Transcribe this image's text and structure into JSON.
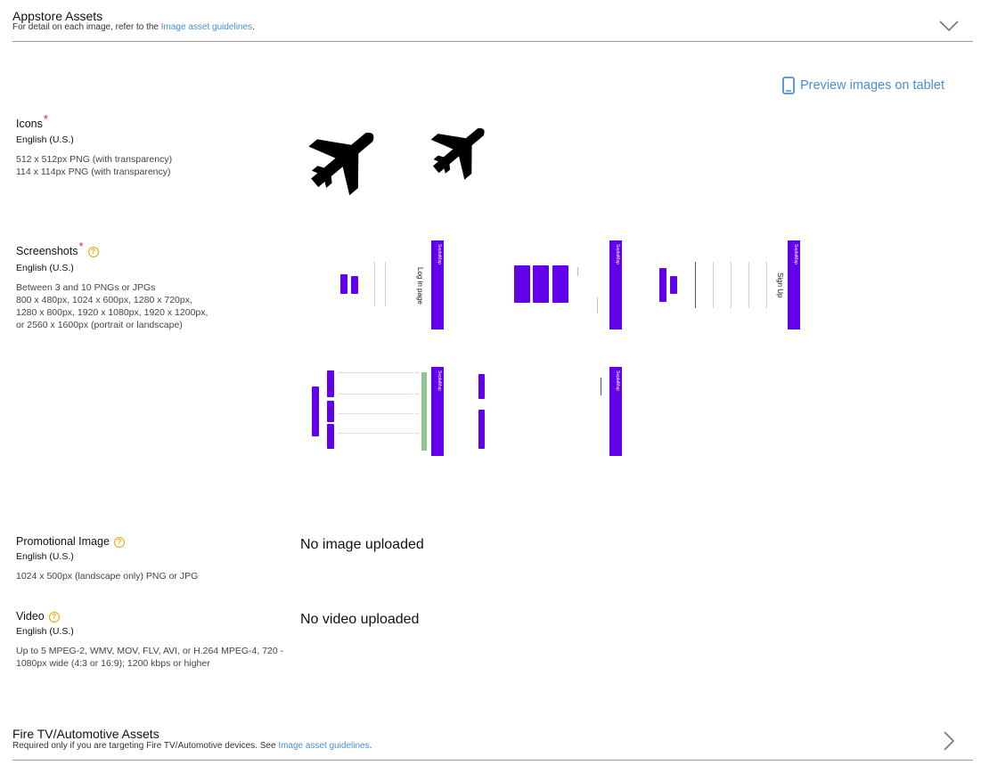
{
  "appstore": {
    "title": "Appstore Assets",
    "subtitle_prefix": "For detail on each image, refer to the ",
    "subtitle_link": "Image asset guidelines",
    "subtitle_suffix": "."
  },
  "preview_link": "Preview images on tablet",
  "icons": {
    "label": "Icons",
    "required_mark": "*",
    "locale": "English (U.S.)",
    "specs": [
      "512 x 512px PNG (with transparency)",
      "114 x 114px PNG (with transparency)"
    ]
  },
  "screenshots": {
    "label": "Screenshots",
    "required_mark": "*",
    "help": "?",
    "locale": "English (U.S.)",
    "specs": [
      "Between 3 and 10 PNGs or JPGs",
      "800 x 480px, 1024 x 600px, 1280 x 720px,",
      "1280 x 800px, 1920 x 1080px, 1920 x 1200px,",
      "or 2560 x 1600px (portrait or landscape)"
    ],
    "thumbs": {
      "app_name": "SeptaMap",
      "login_title": "Log in page",
      "signup_title": "Sign Up"
    }
  },
  "promo": {
    "label": "Promotional Image",
    "help": "?",
    "locale": "English (U.S.)",
    "spec": "1024 x 500px (landscape only) PNG or JPG",
    "status": "No image uploaded"
  },
  "video": {
    "label": "Video",
    "help": "?",
    "locale": "English (U.S.)",
    "specs": [
      "Up to 5 MPEG-2, WMV, MOV, FLV, AVI, or H.264 MPEG-4, 720 -",
      "1080px wide (4:3 or 16:9); 1200 kbps or higher"
    ],
    "status": "No video uploaded"
  },
  "firetv": {
    "title": "Fire TV/Automotive Assets",
    "subtitle_prefix": "Required only if you are targeting Fire TV/Automotive devices. See ",
    "subtitle_link": "Image asset guidelines",
    "subtitle_suffix": "."
  },
  "colors": {
    "accent": "#6200ea",
    "link": "#4a8fd6",
    "required": "#dd2222",
    "help": "#f0a500"
  }
}
